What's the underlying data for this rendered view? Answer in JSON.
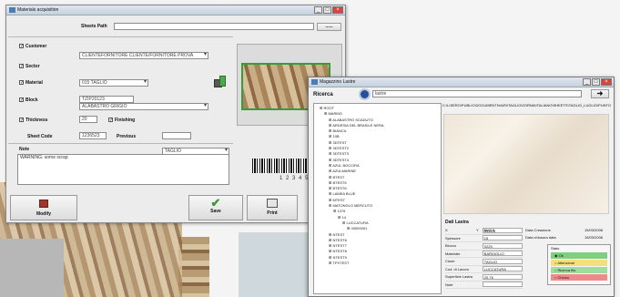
{
  "win1": {
    "title": "Materials acquisition",
    "sheets_path_label": "Sheets Path",
    "sheets_path_value": "",
    "browse_label": "......",
    "customer_label": "Customer",
    "customer_value": "CLIENTEFORNITORE CLIENTE/FORNITORE PROVA",
    "sector_label": "Sector",
    "sector_value": "015 TAGLIO",
    "material_label": "Material",
    "material_value": "ALABASTRO GRIGIO",
    "block_label": "Block",
    "block_value": "TZIP20123",
    "thickness_label": "Thickness",
    "thickness_value": "20",
    "finishing_label": "Finishing",
    "finishing_value": "TAGLIO",
    "sheet_code_label": "Sheet Code",
    "sheet_code_value": "1236523",
    "previous_label": "Previous",
    "previous_value": "",
    "note_label": "Note",
    "note_value": "WARNING: some scrap",
    "modify_label": "Modify",
    "save_label": "Save",
    "print_label": "Print",
    "barcode_digits": "1 2 3 4 5"
  },
  "win2": {
    "title": "Magazzino Lastre",
    "search_label": "Ricerca",
    "search_value": "lastre",
    "path_text": "C:\\LISERO\\PUBLIC\\DOCUMENTI\\VARI\\TAGLIO\\ZORNA\\ITALIANO\\SHEETS\\TAGLIO_LUGLIO\\PUNTO_LUGLIO\\1252.png",
    "tree": [
      "ROOT",
      "MARMO",
      "ALABASTRO SCADUTO",
      "ARDESIA DEL BRASILE NERA",
      "BIANCA",
      "10B",
      "3DTEST",
      "3DTEST2",
      "3DTEST3",
      "3DTEST4",
      "AZUL BOCCIRA",
      "AZULMARINE",
      "BTEST",
      "BTEST5",
      "BTEST6",
      "LAMEA BLUE",
      "MTEST",
      "MATONGLO MERCUTO",
      "1276",
      "14",
      "LUCCATURA",
      "00000001",
      "NTEST",
      "NTEST6",
      "NTEST7",
      "NTEST8",
      "NTEST9",
      "TPXTEST"
    ],
    "details_title": "Dati Lastra",
    "details": [
      {
        "k": "X",
        "v": "5915.5"
      },
      {
        "k": "Spessore",
        "v": "15"
      },
      {
        "k": "Blocco",
        "v": "0225"
      },
      {
        "k": "Materiale",
        "v": "BARDIGLIO"
      },
      {
        "k": "Clone",
        "v": "TAGLIO"
      },
      {
        "k": "Cod. di Lavoro",
        "v": "LUCCATURA"
      },
      {
        "k": "Superficie Lastra",
        "v": "20.76"
      },
      {
        "k": "Note",
        "v": ""
      }
    ],
    "y_label": "Y",
    "y_value": "2842.6",
    "date_created_label": "Data Creazione",
    "date_created_value": "15/03/2008",
    "date_closed_label": "Data chiusura data",
    "date_closed_value": "15/03/2008",
    "stato_label": "Stato",
    "stato_options": [
      {
        "label": "Ok",
        "color": "#7ed07e"
      },
      {
        "label": "Attenzione",
        "color": "#f3e07a"
      },
      {
        "label": "Ricerca filo",
        "color": "#9fdc9f"
      },
      {
        "label": "Chiuso",
        "color": "#f08a8a"
      }
    ]
  },
  "colors": {
    "green_accent": "#3a9b3a",
    "titlebar": "#c7d1df",
    "window_bg": "#ececec"
  }
}
